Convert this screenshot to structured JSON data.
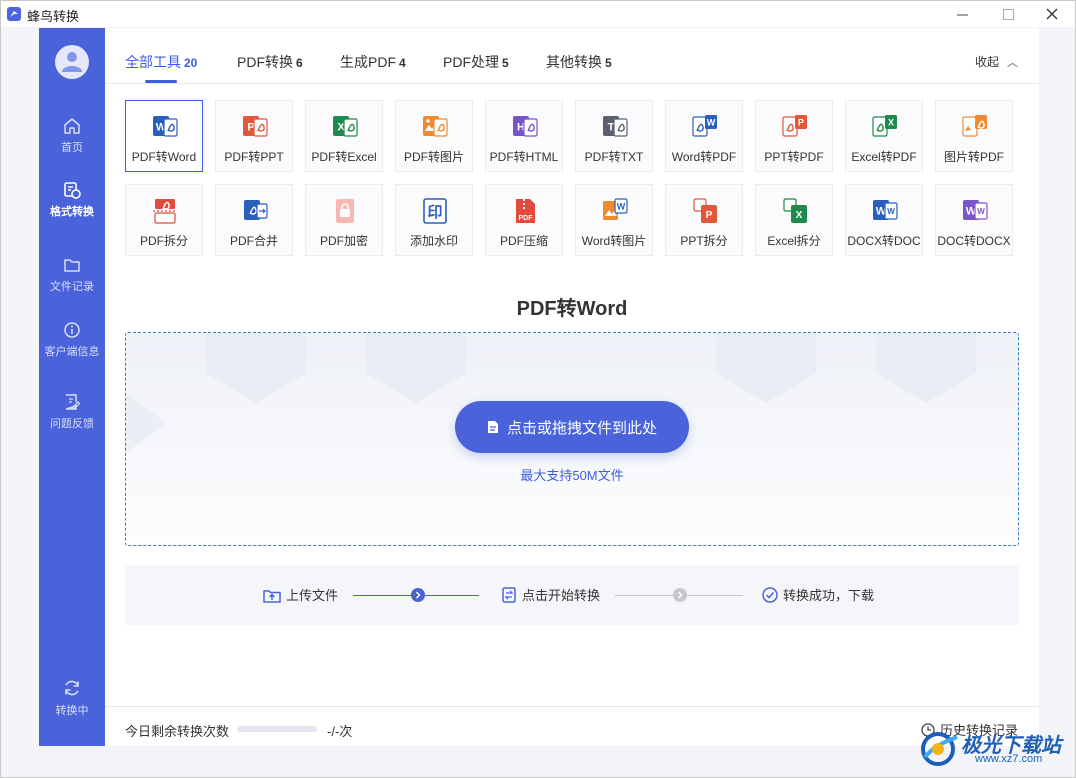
{
  "app": {
    "title": "蜂鸟转换"
  },
  "sidebar": {
    "items": [
      {
        "label": "首页",
        "icon": "home-icon"
      },
      {
        "label": "格式转换",
        "icon": "format-convert-icon",
        "active": true
      },
      {
        "label": "文件记录",
        "icon": "folder-icon"
      },
      {
        "label": "客户端信息",
        "icon": "info-icon"
      },
      {
        "label": "问题反馈",
        "icon": "feedback-icon"
      }
    ],
    "status_label": "转换中"
  },
  "tabs": [
    {
      "label": "全部工具",
      "count": "20",
      "active": true
    },
    {
      "label": "PDF转换",
      "count": "6"
    },
    {
      "label": "生成PDF",
      "count": "4"
    },
    {
      "label": "PDF处理",
      "count": "5"
    },
    {
      "label": "其他转换",
      "count": "5"
    }
  ],
  "collapse_label": "收起",
  "tools": [
    {
      "label": "PDF转Word",
      "icon": "pdf-to-word-icon",
      "active": true
    },
    {
      "label": "PDF转PPT",
      "icon": "pdf-to-ppt-icon"
    },
    {
      "label": "PDF转Excel",
      "icon": "pdf-to-excel-icon"
    },
    {
      "label": "PDF转图片",
      "icon": "pdf-to-image-icon"
    },
    {
      "label": "PDF转HTML",
      "icon": "pdf-to-html-icon"
    },
    {
      "label": "PDF转TXT",
      "icon": "pdf-to-txt-icon"
    },
    {
      "label": "Word转PDF",
      "icon": "word-to-pdf-icon"
    },
    {
      "label": "PPT转PDF",
      "icon": "ppt-to-pdf-icon"
    },
    {
      "label": "Excel转PDF",
      "icon": "excel-to-pdf-icon"
    },
    {
      "label": "图片转PDF",
      "icon": "image-to-pdf-icon"
    },
    {
      "label": "PDF拆分",
      "icon": "pdf-split-icon"
    },
    {
      "label": "PDF合并",
      "icon": "pdf-merge-icon"
    },
    {
      "label": "PDF加密",
      "icon": "pdf-encrypt-icon"
    },
    {
      "label": "添加水印",
      "icon": "watermark-icon"
    },
    {
      "label": "PDF压缩",
      "icon": "pdf-compress-icon"
    },
    {
      "label": "Word转图片",
      "icon": "word-to-image-icon"
    },
    {
      "label": "PPT拆分",
      "icon": "ppt-split-icon"
    },
    {
      "label": "Excel拆分",
      "icon": "excel-split-icon"
    },
    {
      "label": "DOCX转DOC",
      "icon": "docx-to-doc-icon"
    },
    {
      "label": "DOC转DOCX",
      "icon": "doc-to-docx-icon"
    }
  ],
  "section_title": "PDF转Word",
  "dropzone": {
    "button_label": "点击或拖拽文件到此处",
    "hint": "最大支持50M文件"
  },
  "steps": [
    "上传文件",
    "点击开始转换",
    "转换成功，下载"
  ],
  "footer": {
    "remaining_label": "今日剩余转换次数",
    "remaining_value": "-/-次",
    "history_label": "历史转换记录"
  },
  "watermark": {
    "text": "极光下载站",
    "url": "www.xz7.com"
  },
  "colors": {
    "accent": "#4b63da",
    "word": "#2b5fbd",
    "ppt": "#e2573a",
    "excel": "#1e8a4c",
    "image": "#f08a2e",
    "html": "#7a55c7",
    "txt": "#5a6070",
    "pdf": "#e24b3b"
  }
}
